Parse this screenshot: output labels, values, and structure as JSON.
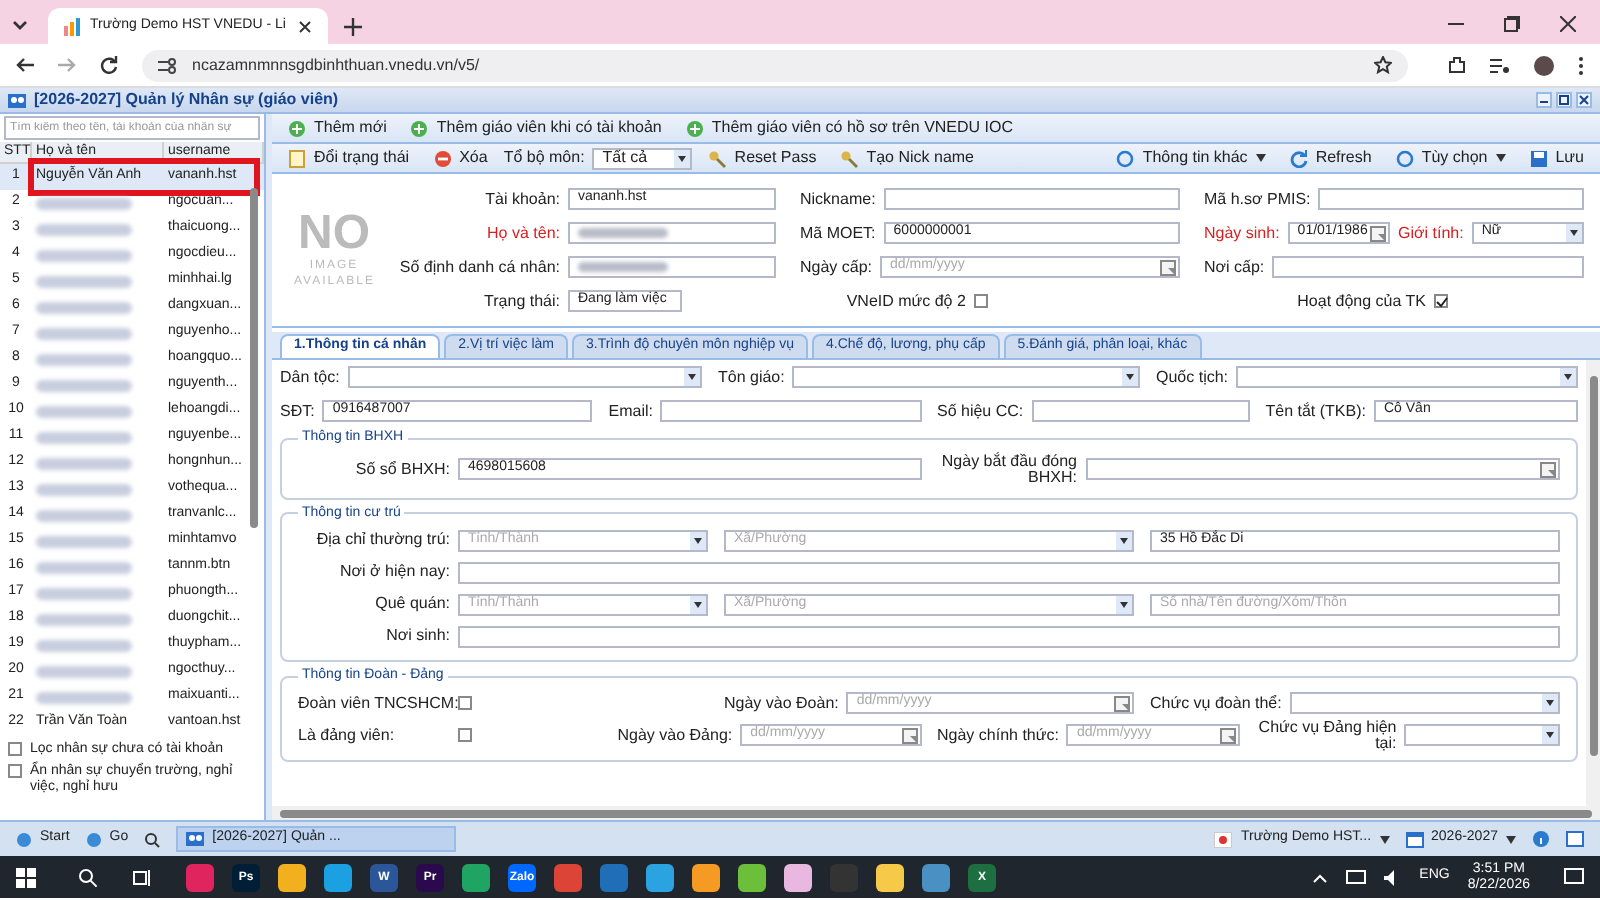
{
  "browser": {
    "tab_title": "Trường Demo HST VNEDU - Li",
    "url": "ncazamnmnnsgdbinhthuan.vnedu.vn/v5/"
  },
  "app": {
    "title": "[2026-2027] Quản lý Nhân sự (giáo viên)"
  },
  "staff_list": {
    "search_placeholder": "Tìm kiếm theo tên, tài khoản của nhân sự",
    "columns": [
      "STT",
      "Họ và tên",
      "username"
    ],
    "rows": [
      {
        "stt": "1",
        "name": "Nguyễn Văn Anh",
        "username": "vananh.hst",
        "selected": true,
        "highlighted": true
      },
      {
        "stt": "2",
        "username": "ngocuan...",
        "selected": false,
        "highlighted": false
      },
      {
        "stt": "3",
        "username": "thaicuong...",
        "selected": false,
        "highlighted": false
      },
      {
        "stt": "4",
        "username": "ngocdieu...",
        "selected": false,
        "highlighted": false
      },
      {
        "stt": "5",
        "username": "minhhai.lg",
        "selected": false,
        "highlighted": false
      },
      {
        "stt": "6",
        "username": "dangxuan...",
        "selected": false,
        "highlighted": false
      },
      {
        "stt": "7",
        "username": "nguyenho...",
        "selected": false,
        "highlighted": false
      },
      {
        "stt": "8",
        "username": "hoangquo...",
        "selected": false,
        "highlighted": false
      },
      {
        "stt": "9",
        "username": "nguyenth...",
        "selected": false,
        "highlighted": false
      },
      {
        "stt": "10",
        "username": "lehoangdi...",
        "selected": false,
        "highlighted": false
      },
      {
        "stt": "11",
        "username": "nguyenbe...",
        "selected": false,
        "highlighted": false
      },
      {
        "stt": "12",
        "username": "hongnhun...",
        "selected": false,
        "highlighted": false
      },
      {
        "stt": "13",
        "username": "vothequa...",
        "selected": false,
        "highlighted": false
      },
      {
        "stt": "14",
        "username": "tranvanlc...",
        "selected": false,
        "highlighted": false
      },
      {
        "stt": "15",
        "username": "minhtamvo",
        "selected": false,
        "highlighted": false
      },
      {
        "stt": "16",
        "username": "tannm.btn",
        "selected": false,
        "highlighted": false
      },
      {
        "stt": "17",
        "username": "phuongth...",
        "selected": false,
        "highlighted": false
      },
      {
        "stt": "18",
        "username": "duongchit...",
        "selected": false,
        "highlighted": false
      },
      {
        "stt": "19",
        "username": "thuypham...",
        "selected": false,
        "highlighted": false
      },
      {
        "stt": "20",
        "username": "ngocthuy...",
        "selected": false,
        "highlighted": false
      },
      {
        "stt": "21",
        "username": "maixuanti...",
        "selected": false,
        "highlighted": false
      },
      {
        "stt": "22",
        "name": "Trần Văn Toàn",
        "username": "vantoan.hst",
        "selected": false,
        "highlighted": false
      }
    ],
    "filters": [
      {
        "label": "Lọc nhân sự chưa có tài khoản",
        "checked": false
      },
      {
        "label": "Ẩn nhân sự chuyển trường, nghỉ việc, nghỉ hưu",
        "checked": false
      }
    ]
  },
  "toolbar_1": [
    {
      "label": "Thêm mới",
      "kind": "add"
    },
    {
      "label": "Thêm giáo viên khi có tài khoản",
      "kind": "add"
    },
    {
      "label": "Thêm giáo viên có hồ sơ trên VNEDU IOC",
      "kind": "add"
    }
  ],
  "toolbar_2": {
    "left": [
      {
        "label": "Đổi trạng thái",
        "kind": "note"
      },
      {
        "label": "Xóa",
        "kind": "delete"
      },
      {
        "label": "Tổ bộ môn:",
        "kind": "label"
      },
      {
        "label": "Tất cả",
        "kind": "select"
      },
      {
        "label": "Reset Pass",
        "kind": "key"
      },
      {
        "label": "Tạo Nick name",
        "kind": "key"
      }
    ],
    "right": [
      {
        "label": "Thông tin khác",
        "kind": "menu"
      },
      {
        "label": "Refresh",
        "kind": "refresh"
      },
      {
        "label": "Tùy chọn",
        "kind": "menu"
      },
      {
        "label": "Lưu",
        "kind": "save"
      }
    ]
  },
  "photo": {
    "big": "NO",
    "small": "IMAGE AVAILABLE"
  },
  "profile": [
    [
      [
        {
          "label": "Tài khoản:",
          "kind": "text",
          "value": "vananh.hst"
        }
      ],
      [
        {
          "label": "Nickname:",
          "kind": "text"
        }
      ],
      [
        {
          "label": "Mã h.sơ PMIS:",
          "kind": "text"
        }
      ]
    ],
    [
      [
        {
          "label": "Họ và tên:",
          "kind": "blurred",
          "required": true
        }
      ],
      [
        {
          "label": "Mã MOET:",
          "kind": "text",
          "value": "6000000001"
        }
      ],
      [
        {
          "label": "Ngày sinh:",
          "kind": "date",
          "value": "01/01/1986",
          "required": true
        },
        {
          "label": "Giới tính:",
          "kind": "select",
          "value": "Nữ",
          "required": true
        }
      ]
    ],
    [
      [
        {
          "label": "Số định danh cá nhân:",
          "kind": "blurred"
        }
      ],
      [
        {
          "label": "Ngày cấp:",
          "kind": "date",
          "placeholder": "dd/mm/yyyy"
        }
      ],
      [
        {
          "label": "Nơi cấp:",
          "kind": "text"
        }
      ]
    ],
    [
      [
        {
          "label": "Trạng thái:",
          "kind": "text",
          "value": "Đang làm việc"
        }
      ],
      [
        {
          "label": "VNeID mức độ 2",
          "kind": "check",
          "checked": false
        }
      ],
      [
        {
          "label": "Hoạt động của TK",
          "kind": "check",
          "checked": true
        }
      ]
    ]
  ],
  "tabs": [
    {
      "label": "1.Thông tin cá nhân",
      "selected": true
    },
    {
      "label": "2.Vị trí việc làm",
      "selected": false
    },
    {
      "label": "3.Trình độ chuyên môn nghiệp vụ",
      "selected": false
    },
    {
      "label": "4.Chế độ, lương, phụ cấp",
      "selected": false
    },
    {
      "label": "5.Đánh giá, phân loại, khác",
      "selected": false
    }
  ],
  "personal": [
    [
      {
        "label": "Dân tộc:",
        "kind": "select"
      },
      {
        "label": "Tôn giáo:",
        "kind": "select"
      },
      {
        "label": "Quốc tịch:",
        "kind": "select"
      }
    ],
    [
      {
        "label": "SĐT:",
        "kind": "text",
        "value": "0916487007"
      },
      {
        "label": "Email:",
        "kind": "text"
      },
      {
        "label": "Số hiệu CC:",
        "kind": "text"
      },
      {
        "label": "Tên tắt (TKB):",
        "kind": "text",
        "value": "Cô Vân"
      }
    ]
  ],
  "sections": [
    {
      "title": "Thông tin BHXH",
      "rows": [
        [
          {
            "label": "Số sổ BHXH:",
            "kind": "text",
            "value": "4698015608"
          },
          {
            "label": "Ngày bắt đầu đóng BHXH:",
            "kind": "date"
          }
        ]
      ]
    },
    {
      "title": "Thông tin cư trú",
      "rows": [
        [
          {
            "label": "Địa chỉ thường trú:",
            "kind": "select",
            "placeholder": "Tỉnh/Thành"
          },
          {
            "kind": "select",
            "placeholder": "Xã/Phường"
          },
          {
            "kind": "text",
            "value": "35 Hồ Đắc Di"
          }
        ],
        [
          {
            "label": "Nơi ở hiện nay:",
            "kind": "text"
          }
        ],
        [
          {
            "label": "Quê quán:",
            "kind": "select",
            "placeholder": "Tỉnh/Thành"
          },
          {
            "kind": "select",
            "placeholder": "Xã/Phường"
          },
          {
            "kind": "text",
            "placeholder": "Số nhà/Tên đường/Xóm/Thôn"
          }
        ],
        [
          {
            "label": "Nơi sinh:",
            "kind": "text"
          }
        ]
      ]
    },
    {
      "title": "Thông tin Đoàn - Đảng",
      "rows": [
        [
          {
            "label": "Đoàn viên TNCSHCM:",
            "kind": "check",
            "checked": false
          },
          {
            "label": "Ngày vào Đoàn:",
            "kind": "date",
            "placeholder": "dd/mm/yyyy"
          },
          {
            "label": "Chức vụ đoàn thể:",
            "kind": "select"
          }
        ],
        [
          {
            "label": "Là đảng viên:",
            "kind": "check",
            "checked": false
          },
          {
            "label": "Ngày vào Đảng:",
            "kind": "date",
            "placeholder": "dd/mm/yyyy"
          },
          {
            "label": "Ngày chính thức:",
            "kind": "date",
            "placeholder": "dd/mm/yyyy"
          },
          {
            "label": "Chức vụ Đảng hiện tại:",
            "kind": "select"
          }
        ]
      ]
    }
  ],
  "app_taskbar": {
    "left": [
      "Start",
      "Go"
    ],
    "window": "[2026-2027] Quản ...",
    "right": [
      "Trường Demo HST...",
      "2026-2027"
    ]
  },
  "windows_taskbar": {
    "apps": [
      {
        "color": "#e0245e"
      },
      {
        "glyph": "Ps",
        "color": "#001e36"
      },
      {
        "color": "#f2b01e"
      },
      {
        "color": "#1ba1e2"
      },
      {
        "glyph": "W",
        "color": "#2b579a"
      },
      {
        "glyph": "Pr",
        "color": "#2a0a4d"
      },
      {
        "color": "#1fa463"
      },
      {
        "glyph": "Zalo",
        "color": "#0068ff"
      },
      {
        "color": "#db4437"
      },
      {
        "color": "#1e6fb8"
      },
      {
        "color": "#2aa3e0"
      },
      {
        "color": "#f59a23"
      },
      {
        "color": "#6bbf3b"
      },
      {
        "color": "#e8b8e0"
      },
      {
        "color": "#333333"
      },
      {
        "color": "#f7c948"
      },
      {
        "color": "#4a90c2"
      },
      {
        "glyph": "X",
        "color": "#1d6f42"
      }
    ],
    "language": "ENG",
    "time": "3:51 PM",
    "date": "8/22/2026"
  }
}
